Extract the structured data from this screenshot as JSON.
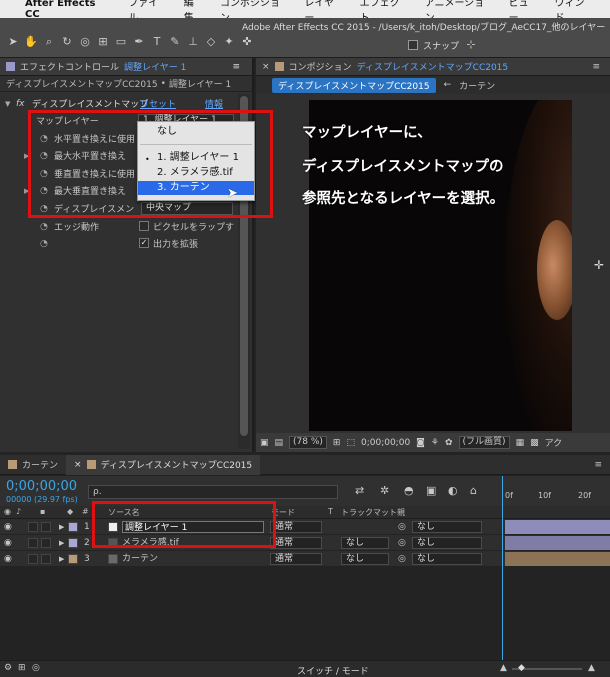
{
  "menubar": {
    "app_name": "After Effects CC",
    "items": [
      "ファイル",
      "編集",
      "コンポジション",
      "レイヤー",
      "エフェクト",
      "アニメーション",
      "ビュー",
      "ウィンド"
    ]
  },
  "toolbar": {
    "window_title": "Adobe After Effects CC 2015 - /Users/k_itoh/Desktop/ブログ_AeCC17_他のレイヤー",
    "snap_label": "スナップ"
  },
  "effect_controls": {
    "tab_prefix": "エフェクトコントロール",
    "tab_layer": "調整レイヤー 1",
    "breadcrumb_comp": "ディスプレイスメントマップCC2015",
    "breadcrumb_sep": "•",
    "breadcrumb_layer": "調整レイヤー 1",
    "effect_name": "ディスプレイスメントマップ",
    "reset_label": "リセット",
    "info_label": "情報",
    "properties": [
      {
        "label": "マップレイヤー",
        "value": "1. 調整レイヤー 1"
      },
      {
        "label": "水平置き換えに使用",
        "value": ""
      },
      {
        "label": "最大水平置き換え",
        "value": ""
      },
      {
        "label": "垂直置き換えに使用",
        "value": ""
      },
      {
        "label": "最大垂直置き換え",
        "value": ""
      },
      {
        "label": "ディスプレイスメン",
        "value": "中央マップ"
      },
      {
        "label": "エッジ動作",
        "value": "ピクセルをラップす"
      },
      {
        "label": "",
        "value": "出力を拡張"
      }
    ]
  },
  "popup": {
    "items": [
      "なし",
      "1. 調整レイヤー 1",
      "2. メラメラ感.tif",
      "3. カーテン"
    ],
    "selected_index": 3,
    "checked_index": 1
  },
  "annotation": {
    "lines": [
      "マップレイヤーに、",
      "ディスプレイスメントマップの",
      "参照先となるレイヤーを選択。"
    ],
    "color": "#e01010"
  },
  "composition": {
    "tab_prefix": "コンポジション",
    "tab_name": "ディスプレイスメントマップCC2015",
    "subtab_active": "ディスプレイスメントマップCC2015",
    "subtab_next": "カーテン",
    "zoom": "(78 %)",
    "timecode": "0;00;00;00",
    "quality": "(フル画質)",
    "active_label": "アク"
  },
  "timeline": {
    "tab_inactive": "カーテン",
    "tab_active": "ディスプレイスメントマップCC2015",
    "timecode": "0;00;00;00",
    "fps": "00000 (29.97 fps)",
    "search_placeholder": "ρ.",
    "ruler": [
      "0f",
      "10f",
      "20f"
    ],
    "columns": {
      "source": "ソース名",
      "mode": "モード",
      "t": "T",
      "trackmatte": "トラックマット",
      "parent": "親"
    },
    "layers": [
      {
        "num": "1",
        "name": "調整レイヤー 1",
        "mode": "通常",
        "trackmatte": "",
        "parent": "なし",
        "label_color": "#a9a7d4",
        "bar_color": "#8e8cb8"
      },
      {
        "num": "2",
        "name": "メラメラ感.tif",
        "mode": "通常",
        "trackmatte": "なし",
        "parent": "なし",
        "label_color": "#a9a7d4",
        "bar_color": "#7f7da6"
      },
      {
        "num": "3",
        "name": "カーテン",
        "mode": "通常",
        "trackmatte": "なし",
        "parent": "なし",
        "label_color": "#b99a78",
        "bar_color": "#8c7358"
      }
    ],
    "footer_label": "スイッチ / モード"
  }
}
